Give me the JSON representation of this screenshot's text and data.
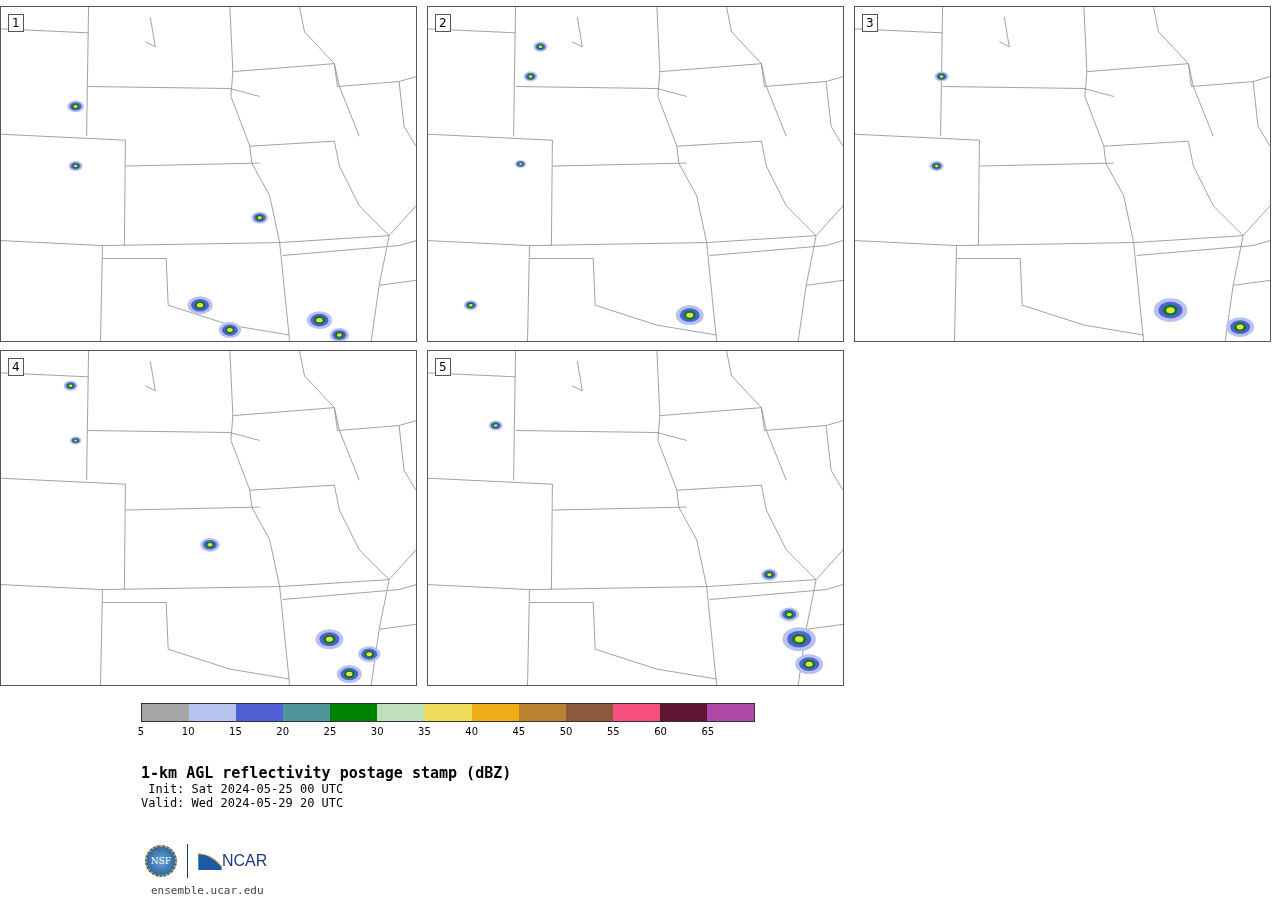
{
  "panels": [
    {
      "label": "1"
    },
    {
      "label": "2"
    },
    {
      "label": "3"
    },
    {
      "label": "4"
    },
    {
      "label": "5"
    }
  ],
  "colorbar": {
    "swatches": [
      {
        "color": "#a5a5a5"
      },
      {
        "color": "#b8c2ee"
      },
      {
        "color": "#5260d6"
      },
      {
        "color": "#4f969b"
      },
      {
        "color": "#008000"
      },
      {
        "color": "#bfdfbd"
      },
      {
        "color": "#f0dc5c"
      },
      {
        "color": "#f0ac16"
      },
      {
        "color": "#bb822f"
      },
      {
        "color": "#8b5a3c"
      },
      {
        "color": "#f54f7f"
      },
      {
        "color": "#611535"
      },
      {
        "color": "#ae4aa5"
      }
    ],
    "ticks": [
      "5",
      "10",
      "15",
      "20",
      "25",
      "30",
      "35",
      "40",
      "45",
      "50",
      "55",
      "60",
      "65"
    ]
  },
  "title": "1-km AGL reflectivity postage stamp (dBZ)",
  "init": " Init: Sat 2024-05-25 00 UTC",
  "valid": "Valid: Wed 2024-05-29 20 UTC",
  "logos": {
    "nsf": "NSF",
    "ncar": "NCAR"
  },
  "url": "ensemble.ucar.edu"
}
